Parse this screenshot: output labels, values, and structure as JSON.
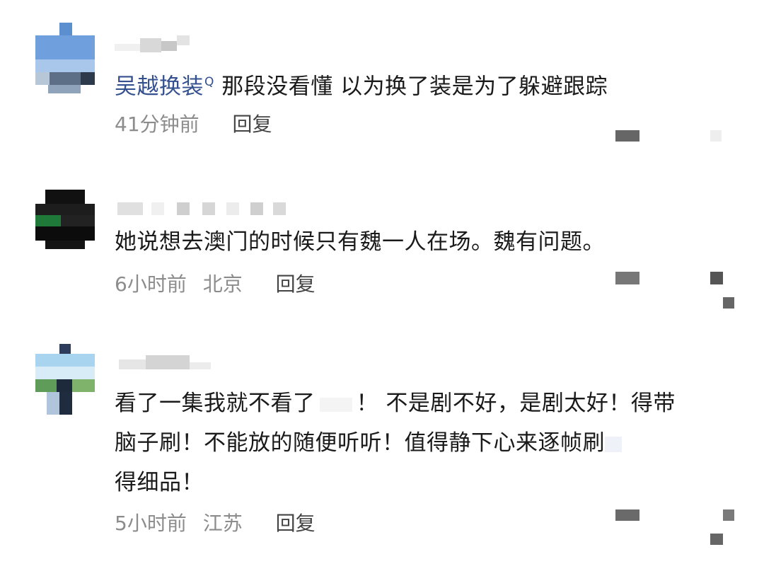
{
  "comments": [
    {
      "topic_link": "吴越换装",
      "search_icon_glyph": "Q",
      "text": "那段没看懂 以为换了装是为了躲避跟踪",
      "time": "41分钟前",
      "location": "",
      "reply_label": "回复"
    },
    {
      "text": "她说想去澳门的时候只有魏一人在场。魏有问题。",
      "time": "6小时前",
      "location": "北京",
      "reply_label": "回复"
    },
    {
      "lines": [
        "看了一集我就不看了",
        "！ 不是剧不好，是剧太好！得带",
        "脑子刷！不能放的随便听听！值得静下心来逐帧刷",
        "得细品！"
      ],
      "time": "5小时前",
      "location": "江苏",
      "reply_label": "回复"
    }
  ]
}
